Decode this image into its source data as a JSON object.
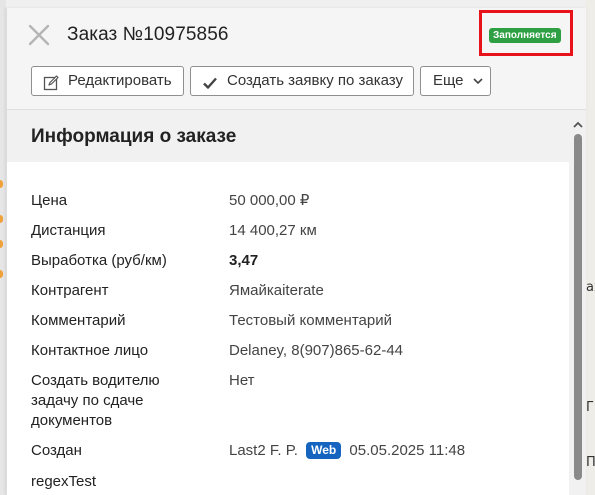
{
  "order": {
    "title": "Заказ №10975856",
    "status": "Заполняется"
  },
  "toolbar": {
    "edit_label": "Редактировать",
    "create_request_label": "Создать заявку по заказу",
    "more_label": "Еще"
  },
  "section": {
    "title": "Информация о заказе"
  },
  "fields": [
    {
      "label": "Цена",
      "value": "50 000,00 ₽"
    },
    {
      "label": "Дистанция",
      "value": "14 400,27 км"
    },
    {
      "label": "Выработка (руб/км)",
      "value": "3,47"
    },
    {
      "label": "Контрагент",
      "value": "Ямайкаiterate"
    },
    {
      "label": "Комментарий",
      "value": "Тестовый комментарий"
    },
    {
      "label": "Контактное лицо",
      "value": "Delaney, 8(907)865-62-44"
    },
    {
      "label": "Создать водителю задачу по сдаче документов",
      "value": "Нет"
    },
    {
      "label": "Создан",
      "value_name": "Last2 F. P.",
      "value_source": "Web",
      "value_date": "05.05.2025 11:48"
    },
    {
      "label": "regexTest",
      "value": ""
    }
  ],
  "map_glyphs": [
    "ах",
    "П",
    "Г"
  ],
  "colors": {
    "status_badge": "#2ea043",
    "highlight_box": "#e8121b",
    "web_badge": "#1565c0"
  }
}
